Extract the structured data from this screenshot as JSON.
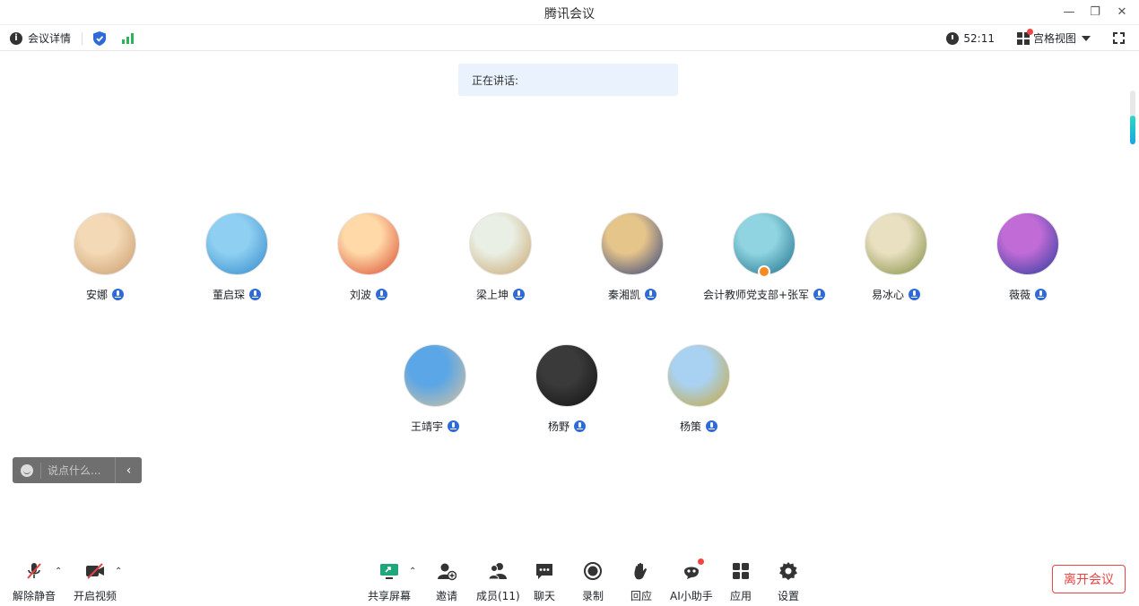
{
  "window": {
    "title": "腾讯会议",
    "controls": {
      "minimize": "—",
      "restore": "❐",
      "close": "✕"
    }
  },
  "infobar": {
    "meeting_info_label": "会议详情",
    "timer": "52:11",
    "view_mode_label": "宫格视图"
  },
  "speaking": {
    "label": "正在讲话:"
  },
  "participants": [
    {
      "name": "安娜",
      "avatar_colors": [
        "#f3d9b5",
        "#c89a6b"
      ]
    },
    {
      "name": "董启琛",
      "avatar_colors": [
        "#8fd0f2",
        "#2f86c8"
      ]
    },
    {
      "name": "刘波",
      "avatar_colors": [
        "#ffd9a8",
        "#d9482c"
      ]
    },
    {
      "name": "梁上坤",
      "avatar_colors": [
        "#e9efe4",
        "#c9a36a"
      ]
    },
    {
      "name": "秦湘凯",
      "avatar_colors": [
        "#e6c58b",
        "#2b3c7a"
      ]
    },
    {
      "name": "会计教师党支部+张军",
      "avatar_colors": [
        "#8fd4e0",
        "#1a6b8a"
      ]
    },
    {
      "name": "易冰心",
      "avatar_colors": [
        "#e9e0c2",
        "#7e8a3a"
      ]
    },
    {
      "name": "薇薇",
      "avatar_colors": [
        "#c16bd6",
        "#263a9a"
      ]
    },
    {
      "name": "王靖宇",
      "avatar_colors": [
        "#5aa6e6",
        "#d8c4a0"
      ]
    },
    {
      "name": "杨野",
      "avatar_colors": [
        "#3a3a3a",
        "#111111"
      ]
    },
    {
      "name": "杨策",
      "avatar_colors": [
        "#a9d2f2",
        "#c9a531"
      ]
    }
  ],
  "chat": {
    "placeholder": "说点什么...",
    "collapse_icon": "‹"
  },
  "toolbar": {
    "unmute_label": "解除静音",
    "start_video_label": "开启视频",
    "share_screen_label": "共享屏幕",
    "invite_label": "邀请",
    "members_label": "成员(11)",
    "chat_label": "聊天",
    "record_label": "录制",
    "react_label": "回应",
    "ai_assistant_label": "AI小助手",
    "apps_label": "应用",
    "settings_label": "设置",
    "leave_label": "离开会议"
  },
  "colors": {
    "accent_blue": "#2f6ad9",
    "signal_green": "#2ab55a",
    "leave_red": "#e54545",
    "speaking_bg": "#eaf2fd",
    "host_orange": "#f58a1f"
  }
}
